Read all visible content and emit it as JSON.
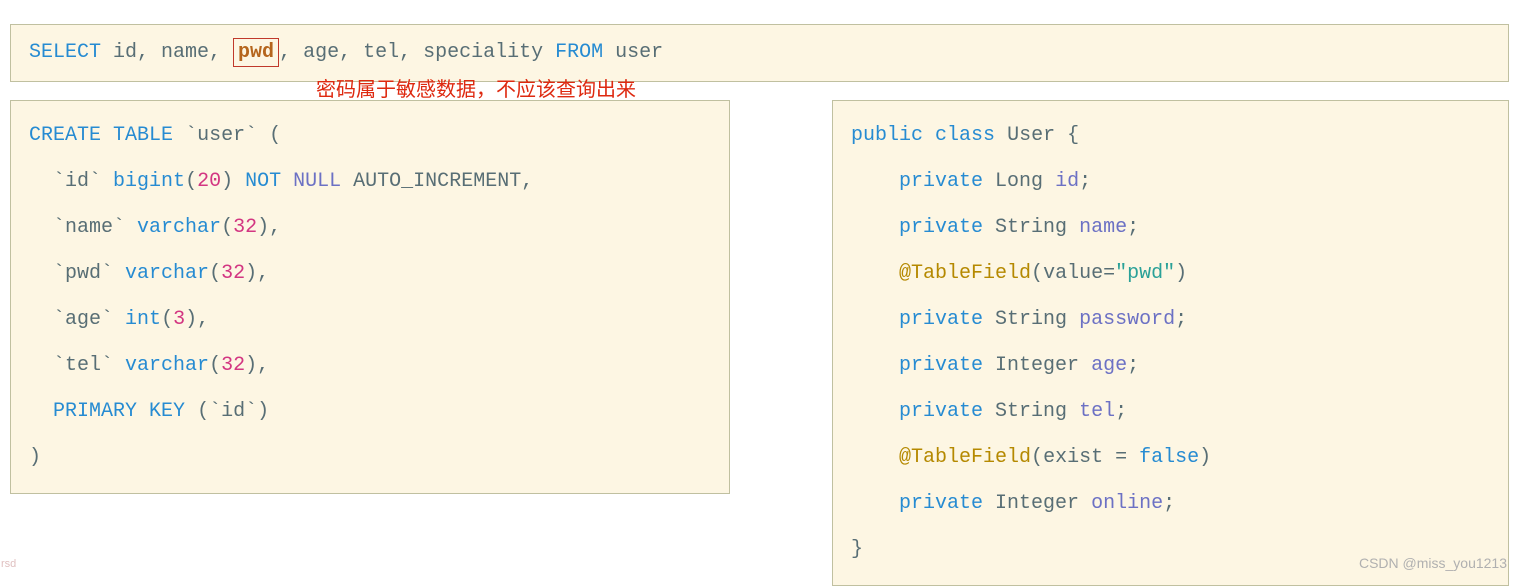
{
  "topQuery": {
    "select": "SELECT",
    "cols_pre": " id, name, ",
    "highlight": "pwd",
    "cols_post": ", age, tel, speciality ",
    "from": "FROM",
    "table": " user"
  },
  "annotation": "密码属于敏感数据，不应该查询出来",
  "leftCode": {
    "create": "CREATE",
    "table": "TABLE",
    "tableName": "`user`",
    "open": " (",
    "rows": [
      {
        "col": "`id`",
        "type": "bigint",
        "num": "20",
        "post1": "NOT",
        "post2": "NULL",
        "post3": "AUTO_INCREMENT",
        "comma": ","
      },
      {
        "col": "`name`",
        "type": "varchar",
        "num": "32",
        "comma": ","
      },
      {
        "col": "`pwd`",
        "type": "varchar",
        "num": "32",
        "comma": ","
      },
      {
        "col": "`age`",
        "type": "int",
        "num": "3",
        "comma": ","
      },
      {
        "col": "`tel`",
        "type": "varchar",
        "num": "32",
        "comma": ","
      }
    ],
    "primary": "PRIMARY",
    "key": "KEY",
    "pkCol": "(`id`)",
    "close": ")"
  },
  "rightCode": {
    "public": "public",
    "class": "class",
    "className": "User",
    "open": "{",
    "lines": [
      {
        "kw": "private",
        "type": "Long",
        "field": "id",
        "end": ";"
      },
      {
        "kw": "private",
        "type": "String",
        "field": "name",
        "end": ";"
      },
      {
        "anno": "@TableField",
        "openP": "(",
        "attr": "value",
        "eq": "=",
        "val": "\"pwd\"",
        "closeP": ")"
      },
      {
        "kw": "private",
        "type": "String",
        "field": "password",
        "end": ";"
      },
      {
        "kw": "private",
        "type": "Integer",
        "field": "age",
        "end": ";"
      },
      {
        "kw": "private",
        "type": "String",
        "field": "tel",
        "end": ";"
      },
      {
        "anno": "@TableField",
        "openP": "(",
        "attr": "exist",
        "eq": " = ",
        "boolval": "false",
        "closeP": ")"
      },
      {
        "kw": "private",
        "type": "Integer",
        "field": "online",
        "end": ";"
      }
    ],
    "close": "}"
  },
  "watermark": "CSDN @miss_you1213",
  "sidetext": "rsd"
}
